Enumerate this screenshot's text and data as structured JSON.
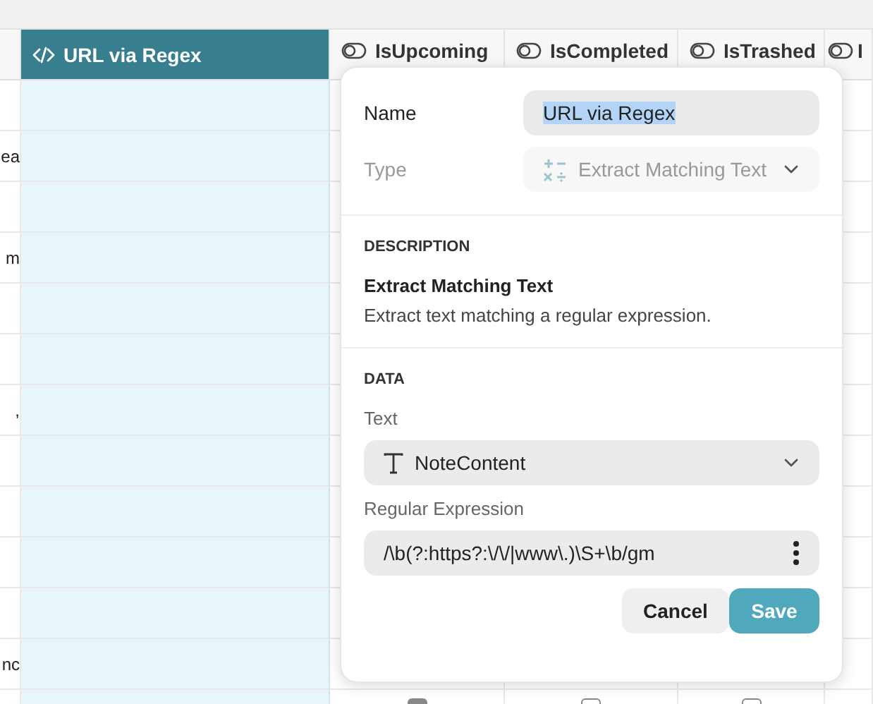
{
  "table": {
    "columns": [
      {
        "kind": "partial"
      },
      {
        "label": "URL via Regex",
        "kind": "formula",
        "selected": true
      },
      {
        "label": "IsUpcoming",
        "kind": "toggle",
        "selected": false
      },
      {
        "label": "IsCompleted",
        "kind": "toggle",
        "selected": false
      },
      {
        "label": "IsTrashed",
        "kind": "toggle",
        "selected": false
      },
      {
        "label": "I",
        "kind": "toggle",
        "selected": false
      }
    ],
    "rows": [
      {},
      {
        "column_1": "ea"
      },
      {},
      {
        "column_1": "m"
      },
      {},
      {},
      {
        "column_1": ","
      },
      {},
      {},
      {},
      {},
      {
        "column_1": "nc"
      },
      {
        "checks": [
          {
            "checked": true
          },
          {
            "checked": false
          },
          {
            "checked": false
          }
        ]
      }
    ]
  },
  "popup": {
    "name": {
      "label": "Name",
      "value": "URL via Regex",
      "selected": true
    },
    "type": {
      "label": "Type",
      "value": "Extract Matching Text",
      "disabled": true
    },
    "description": {
      "heading": "DESCRIPTION",
      "title": "Extract Matching Text",
      "text": "Extract text matching a regular expression."
    },
    "data": {
      "heading": "DATA",
      "text_label": "Text",
      "text_value": "NoteContent",
      "regex_label": "Regular Expression",
      "regex_value": "/\\b(?:https?:\\/\\/|www\\.)\\S+\\b/gm"
    },
    "buttons": [
      {
        "label": "Cancel",
        "kind": "secondary"
      },
      {
        "label": "Save",
        "kind": "primary"
      }
    ]
  }
}
